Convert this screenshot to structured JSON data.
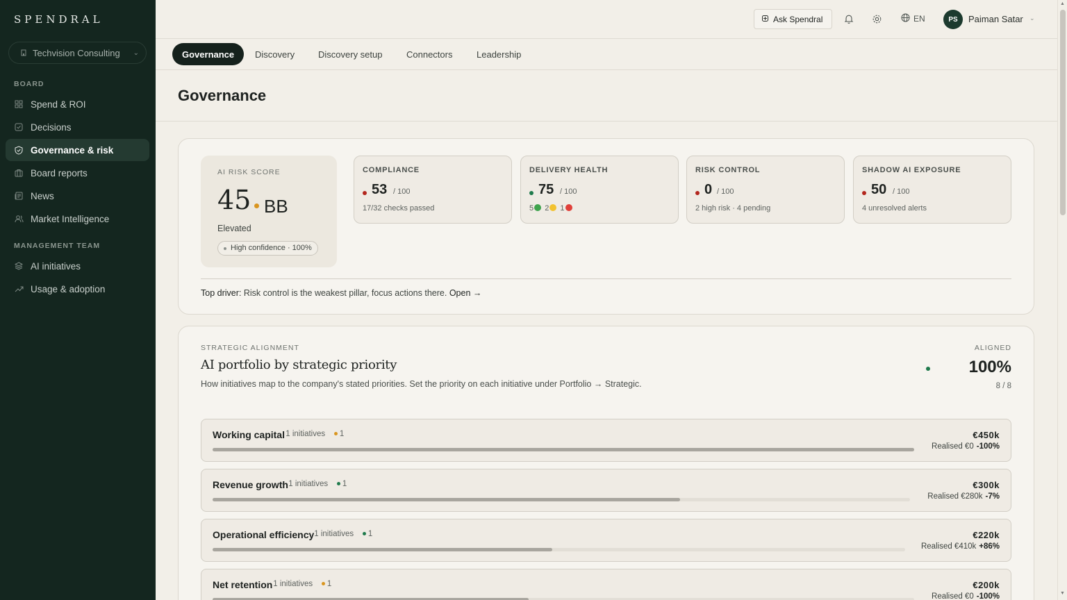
{
  "app": {
    "logo": "SPENDRAL",
    "org": "Techvision Consulting"
  },
  "sidebar": {
    "board_label": "BOARD",
    "mgmt_label": "MANAGEMENT TEAM",
    "board_items": [
      {
        "label": "Spend & ROI",
        "icon": "grid-icon"
      },
      {
        "label": "Decisions",
        "icon": "check-square-icon"
      },
      {
        "label": "Governance & risk",
        "icon": "shield-icon",
        "active": true
      },
      {
        "label": "Board reports",
        "icon": "briefcase-icon"
      },
      {
        "label": "News",
        "icon": "newspaper-icon"
      },
      {
        "label": "Market Intelligence",
        "icon": "users-icon"
      }
    ],
    "mgmt_items": [
      {
        "label": "AI initiatives",
        "icon": "layers-icon"
      },
      {
        "label": "Usage & adoption",
        "icon": "trend-up-icon"
      }
    ]
  },
  "topbar": {
    "ask_label": "Ask Spendral",
    "lang": "EN",
    "avatar_initials": "PS",
    "user_name": "Paiman Satar"
  },
  "tabs": [
    "Governance",
    "Discovery",
    "Discovery setup",
    "Connectors",
    "Leadership"
  ],
  "page": {
    "title": "Governance"
  },
  "risk": {
    "label": "AI RISK SCORE",
    "score": "45",
    "grade": "BB",
    "status": "Elevated",
    "confidence": "High confidence · 100%",
    "pillars": [
      {
        "label": "COMPLIANCE",
        "value": "53",
        "max": "/ 100",
        "sub": "17/32 checks passed",
        "dot": "#b3261e"
      },
      {
        "label": "DELIVERY HEALTH",
        "value": "75",
        "max": "/ 100",
        "sub_parts": [
          "5",
          "2",
          "1"
        ],
        "dot": "#1f7a4c"
      },
      {
        "label": "RISK CONTROL",
        "value": "0",
        "max": "/ 100",
        "sub": "2 high risk · 4 pending",
        "dot": "#b3261e"
      },
      {
        "label": "SHADOW AI EXPOSURE",
        "value": "50",
        "max": "/ 100",
        "sub": "4 unresolved alerts",
        "dot": "#b3261e"
      }
    ],
    "driver_label": "Top driver:",
    "driver_text": " Risk control is the weakest pillar, focus actions there. ",
    "driver_link": "Open →"
  },
  "strategic": {
    "label": "STRATEGIC ALIGNMENT",
    "title": "AI portfolio by strategic priority",
    "desc": "How initiatives map to the company's stated priorities. Set the priority on each initiative under Portfolio → Strategic.",
    "aligned_label": "ALIGNED",
    "aligned_value": "100%",
    "aligned_count": "8 / 8",
    "rows": [
      {
        "name": "Working capital",
        "meta": "1 initiatives",
        "count": "1",
        "dot": "#d9951f",
        "amount": "€450k",
        "realised": "Realised €0",
        "delta": "-100%",
        "progress": 1.0
      },
      {
        "name": "Revenue growth",
        "meta": "1 initiatives",
        "count": "1",
        "dot": "#1f7a4c",
        "amount": "€300k",
        "realised": "Realised €280k",
        "delta": "-7%",
        "progress": 0.67
      },
      {
        "name": "Operational efficiency",
        "meta": "1 initiatives",
        "count": "1",
        "dot": "#1f7a4c",
        "amount": "€220k",
        "realised": "Realised €410k",
        "delta": "+86%",
        "progress": 0.49
      },
      {
        "name": "Net retention",
        "meta": "1 initiatives",
        "count": "1",
        "dot": "#d9951f",
        "amount": "€200k",
        "realised": "Realised €0",
        "delta": "-100%",
        "progress": 0.45
      }
    ]
  },
  "colors": {
    "sidebar_bg": "#14261f",
    "accent_green": "#1f7a4c",
    "accent_amber": "#d9951f",
    "accent_red": "#b3261e"
  }
}
